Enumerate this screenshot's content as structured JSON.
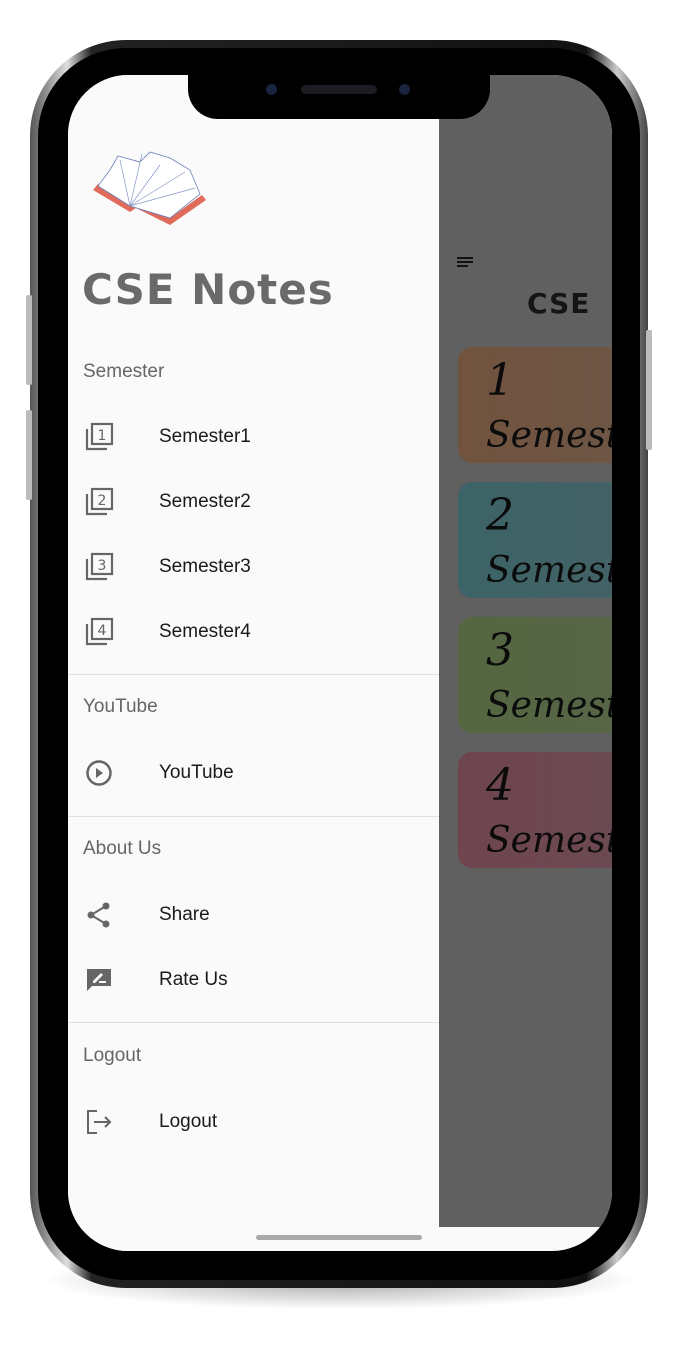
{
  "drawer": {
    "brand": "CSE Notes",
    "sections": [
      {
        "header": "Semester",
        "items": [
          {
            "label": "Semester1",
            "icon": "filter-1-icon",
            "num": "1"
          },
          {
            "label": "Semester2",
            "icon": "filter-2-icon",
            "num": "2"
          },
          {
            "label": "Semester3",
            "icon": "filter-3-icon",
            "num": "3"
          },
          {
            "label": "Semester4",
            "icon": "filter-4-icon",
            "num": "4"
          }
        ]
      },
      {
        "header": "YouTube",
        "items": [
          {
            "label": "YouTube",
            "icon": "youtube-icon"
          }
        ]
      },
      {
        "header": "About Us",
        "items": [
          {
            "label": "Share",
            "icon": "share-icon"
          },
          {
            "label": "Rate Us",
            "icon": "rate-review-icon"
          }
        ]
      },
      {
        "header": "Logout",
        "items": [
          {
            "label": "Logout",
            "icon": "logout-icon"
          }
        ]
      }
    ]
  },
  "main": {
    "title": "CSE",
    "cards": [
      {
        "num": "1",
        "label": "Semester",
        "color": "#c9773f"
      },
      {
        "num": "2",
        "label": "Semester",
        "color": "#3aa3ad"
      },
      {
        "num": "3",
        "label": "Semester",
        "color": "#7bad45"
      },
      {
        "num": "4",
        "label": "Semester",
        "color": "#c4506c"
      }
    ]
  },
  "colors": {
    "scrim": "#606060",
    "drawer_bg": "#fafafa",
    "brand_text": "#6a6a6a"
  }
}
